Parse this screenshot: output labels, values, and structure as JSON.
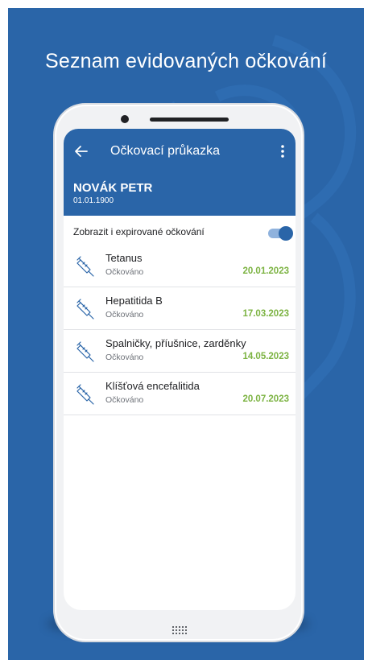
{
  "promo": {
    "title": "Seznam evidovaných očkování"
  },
  "app": {
    "title": "Očkovací průkazka",
    "back_icon": "arrow-left-icon",
    "menu_icon": "more-vertical-icon",
    "accent_color": "#2a65a8",
    "date_color": "#7cb342"
  },
  "patient": {
    "name": "NOVÁK PETR",
    "birth_date": "01.01.1900"
  },
  "filter": {
    "label": "Zobrazit i expirované očkování",
    "enabled": true
  },
  "vaccinations": [
    {
      "name": "Tetanus",
      "status": "Očkováno",
      "date": "20.01.2023",
      "icon": "syringe-icon"
    },
    {
      "name": "Hepatitida B",
      "status": "Očkováno",
      "date": "17.03.2023",
      "icon": "syringe-icon"
    },
    {
      "name": "Spalničky, příušnice, zarděnky",
      "status": "Očkováno",
      "date": "14.05.2023",
      "icon": "syringe-icon"
    },
    {
      "name": "Klíšťová encefalitida",
      "status": "Očkováno",
      "date": "20.07.2023",
      "icon": "syringe-icon"
    }
  ]
}
